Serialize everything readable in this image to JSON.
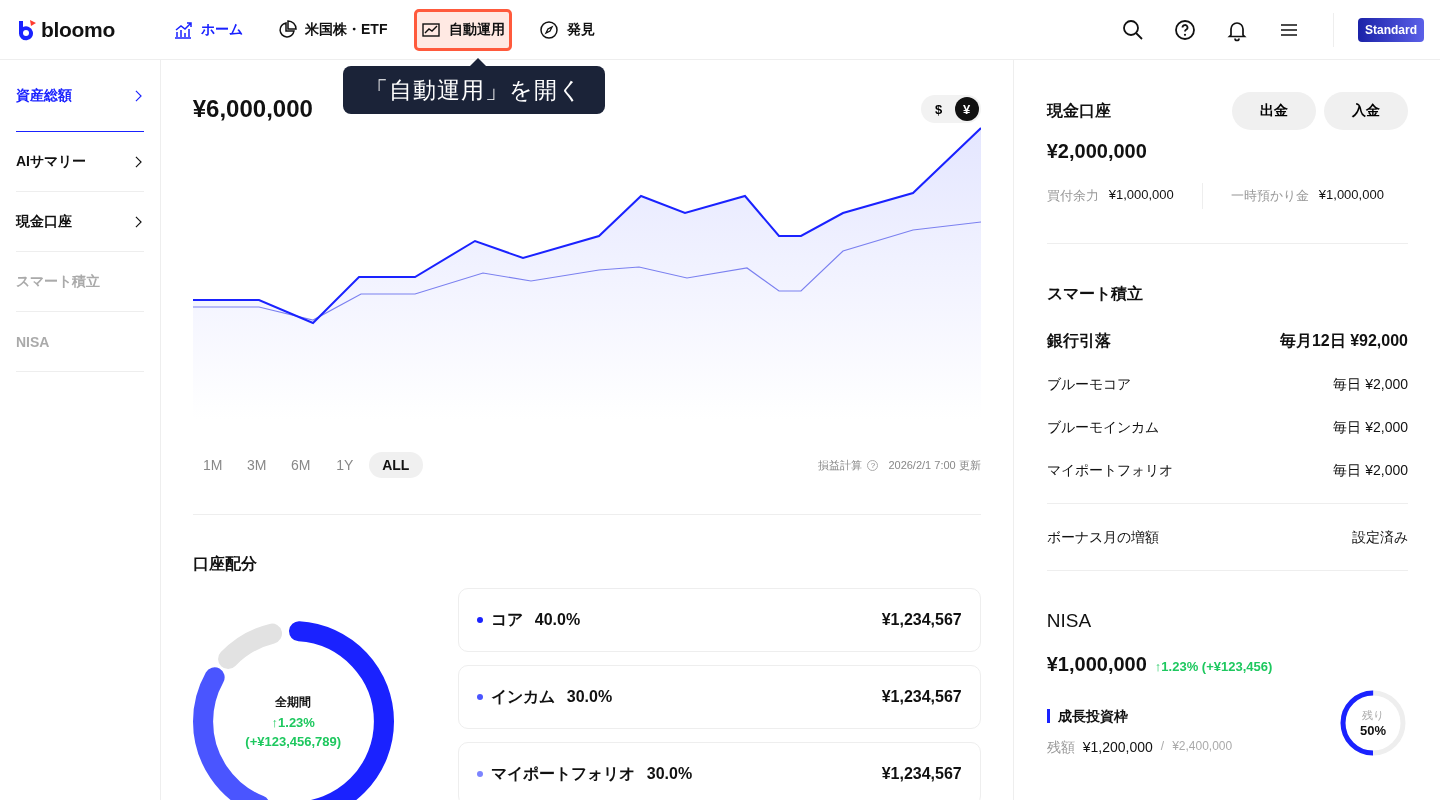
{
  "header": {
    "logo": "bloomo",
    "nav": [
      {
        "label": "ホーム",
        "kind": "chart",
        "selected": true,
        "highlighted": false
      },
      {
        "label": "米国株・ETF",
        "kind": "pie",
        "selected": false,
        "highlighted": false
      },
      {
        "label": "自動運用",
        "kind": "trend",
        "selected": false,
        "highlighted": true
      },
      {
        "label": "発見",
        "kind": "compass",
        "selected": false,
        "highlighted": false
      }
    ],
    "plan_badge": "Standard"
  },
  "tooltip": "「自動運用」を開く",
  "sidebar": {
    "items": [
      {
        "label": "資産総額",
        "selected": true,
        "disabled": false
      },
      {
        "label": "AIサマリー",
        "selected": false,
        "disabled": false
      },
      {
        "label": "現金口座",
        "selected": false,
        "disabled": false
      },
      {
        "label": "スマート積立",
        "selected": false,
        "disabled": true
      },
      {
        "label": "NISA",
        "selected": false,
        "disabled": true
      }
    ]
  },
  "total": {
    "amount": "¥6,000,000",
    "currency_toggle": [
      {
        "label": "$",
        "selected": false
      },
      {
        "label": "¥",
        "selected": true
      }
    ]
  },
  "periods": [
    {
      "label": "1M",
      "selected": false
    },
    {
      "label": "3M",
      "selected": false
    },
    {
      "label": "6M",
      "selected": false
    },
    {
      "label": "1Y",
      "selected": false
    },
    {
      "label": "ALL",
      "selected": true
    }
  ],
  "chart_note": {
    "label": "損益計算",
    "help": "?",
    "updated": "2026/2/1 7:00 更新"
  },
  "allocation": {
    "title": "口座配分",
    "center": {
      "label": "全期間",
      "change": "↑1.23%",
      "amount": "(+¥123,456,789)"
    },
    "items": [
      {
        "name": "コア",
        "percent": "40.0%",
        "amount": "¥1,234,567",
        "color": "#1a22ff"
      },
      {
        "name": "インカム",
        "percent": "30.0%",
        "amount": "¥1,234,567",
        "color": "#4a55ff"
      },
      {
        "name": "マイポートフォリオ",
        "percent": "30.0%",
        "amount": "¥1,234,567",
        "color": "#7c84ff"
      }
    ]
  },
  "cash": {
    "title": "現金口座",
    "buttons": [
      "出金",
      "入金"
    ],
    "amount": "¥2,000,000",
    "details": [
      {
        "label": "買付余力",
        "value": "¥1,000,000"
      },
      {
        "label": "一時預かり金",
        "value": "¥1,000,000"
      }
    ]
  },
  "smart": {
    "title": "スマート積立",
    "rows": [
      {
        "label": "銀行引落",
        "value": "毎月12日 ¥92,000",
        "kind": "total"
      },
      {
        "label": "ブルーモコア",
        "value": "毎日 ¥2,000",
        "kind": "plan"
      },
      {
        "label": "ブルーモインカム",
        "value": "毎日 ¥2,000",
        "kind": "plan"
      },
      {
        "label": "マイポートフォリオ",
        "value": "毎日 ¥2,000",
        "kind": "plan"
      }
    ],
    "bonus": {
      "label": "ボーナス月の増額",
      "value": "設定済み"
    }
  },
  "nisa": {
    "title": "NISA",
    "amount": "¥1,000,000",
    "change": "↑1.23% (+¥123,456)",
    "frame": "成長投資枠",
    "balance_label": "残額",
    "balance": "¥1,200,000",
    "sep": "/",
    "limit": "¥2,400,000",
    "ring": {
      "label": "残り",
      "value": "50%",
      "level": 0.5
    }
  }
}
